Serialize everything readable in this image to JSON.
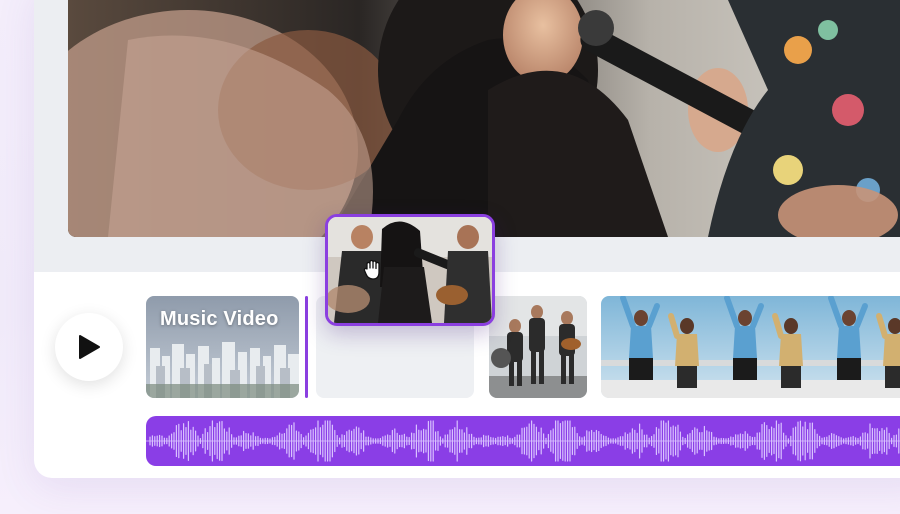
{
  "timeline": {
    "clips": [
      {
        "title": "Music Video",
        "thumbnail": "city-skyline"
      },
      {
        "thumbnail": "band-performance"
      },
      {
        "thumbnail": "dancers-on-rooftop"
      }
    ],
    "dragged_clip": {
      "thumbnail": "singer-with-guitarists"
    }
  },
  "icons": {
    "play": "play-icon",
    "cursor": "grab-hand-icon"
  },
  "colors": {
    "accent": "#8b3fe0",
    "audio_track": "#8a3ee6",
    "waveform": "#d9c2ff"
  }
}
